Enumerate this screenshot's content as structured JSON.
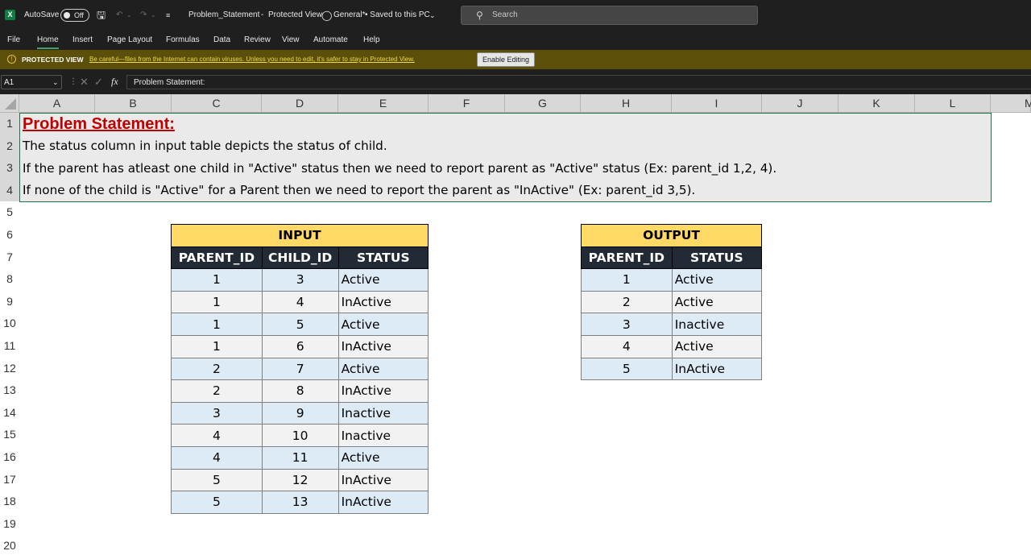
{
  "titlebar": {
    "app_icon": "X",
    "autosave_label": "AutoSave",
    "autosave_state": "Off",
    "filename": "Problem_Statement",
    "separator": "-",
    "mode": "Protected View",
    "label_sensitivity": "General*",
    "saved_status": "• Saved to this PC",
    "search_placeholder": "Search"
  },
  "ribbon": {
    "tabs": [
      "File",
      "Home",
      "Insert",
      "Page Layout",
      "Formulas",
      "Data",
      "Review",
      "View",
      "Automate",
      "Help"
    ],
    "active_tab": "Home"
  },
  "protected_view": {
    "title": "PROTECTED VIEW",
    "message": "Be careful—files from the Internet can contain viruses. Unless you need to edit, it's safer to stay in Protected View.",
    "enable_button": "Enable Editing",
    "accent_color": "#5c4f0a"
  },
  "formula_bar": {
    "name_box": "A1",
    "fx_label": "fx",
    "content": "Problem Statement:"
  },
  "grid": {
    "columns": [
      "A",
      "B",
      "C",
      "D",
      "E",
      "F",
      "G",
      "H",
      "I",
      "J",
      "K",
      "L",
      "M"
    ],
    "rows": [
      "1",
      "2",
      "3",
      "4",
      "5",
      "6",
      "7",
      "8",
      "9",
      "10",
      "11",
      "12",
      "13",
      "14",
      "15",
      "16",
      "17",
      "18",
      "19",
      "20"
    ],
    "selection_color": "#217346"
  },
  "sheet": {
    "title": "Problem Statement:",
    "lines": [
      "The status column in input table depicts the status of child.",
      "If the parent has atleast one child in \"Active\" status then we need to report parent as \"Active\" status (Ex: parent_id 1,2, 4).",
      "If none of the child is \"Active\" for a Parent then we need to report the parent as \"InActive\" (Ex: parent_id 3,5)."
    ]
  },
  "input_table": {
    "caption": "INPUT",
    "headers": [
      "PARENT_ID",
      "CHILD_ID",
      "STATUS"
    ],
    "rows": [
      [
        "1",
        "3",
        "Active"
      ],
      [
        "1",
        "4",
        "InActive"
      ],
      [
        "1",
        "5",
        "Active"
      ],
      [
        "1",
        "6",
        "InActive"
      ],
      [
        "2",
        "7",
        "Active"
      ],
      [
        "2",
        "8",
        "InActive"
      ],
      [
        "3",
        "9",
        "Inactive"
      ],
      [
        "4",
        "10",
        "Inactive"
      ],
      [
        "4",
        "11",
        "Active"
      ],
      [
        "5",
        "12",
        "InActive"
      ],
      [
        "5",
        "13",
        "InActive"
      ]
    ]
  },
  "output_table": {
    "caption": "OUTPUT",
    "headers": [
      "PARENT_ID",
      "STATUS"
    ],
    "rows": [
      [
        "1",
        "Active"
      ],
      [
        "2",
        "Active"
      ],
      [
        "3",
        "Inactive"
      ],
      [
        "4",
        "Active"
      ],
      [
        "5",
        "InActive"
      ]
    ]
  },
  "colors": {
    "caption_bg": "#ffd966",
    "header_bg": "#222a35",
    "row_odd": "#ddebf7",
    "row_even": "#f2f2f2",
    "title_red": "#c00000"
  }
}
